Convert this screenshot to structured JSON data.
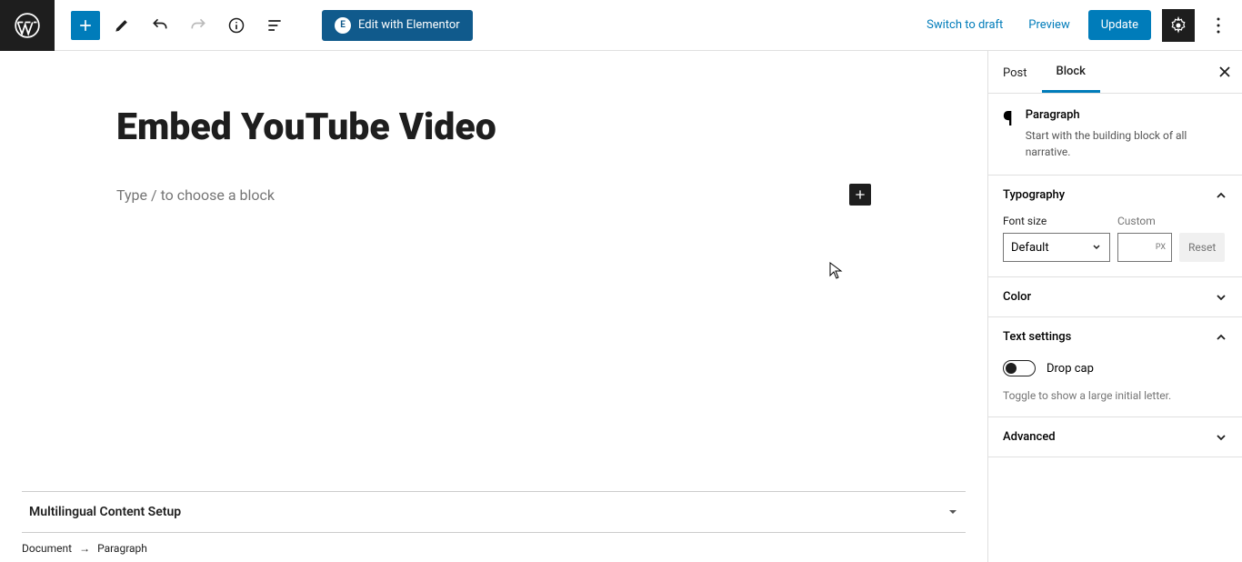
{
  "header": {
    "elementor_label": "Edit with Elementor",
    "switch_draft": "Switch to draft",
    "preview": "Preview",
    "update": "Update"
  },
  "editor": {
    "title": "Embed YouTube Video",
    "block_placeholder": "Type / to choose a block"
  },
  "footer": {
    "metabox_title": "Multilingual Content Setup",
    "breadcrumb_root": "Document",
    "breadcrumb_leaf": "Paragraph"
  },
  "sidebar": {
    "tabs": {
      "post": "Post",
      "block": "Block"
    },
    "block_info": {
      "title": "Paragraph",
      "desc": "Start with the building block of all narrative."
    },
    "typography": {
      "title": "Typography",
      "font_size_label": "Font size",
      "custom_label": "Custom",
      "default_option": "Default",
      "px_unit": "PX",
      "reset": "Reset"
    },
    "color": {
      "title": "Color"
    },
    "text_settings": {
      "title": "Text settings",
      "drop_cap": "Drop cap",
      "hint": "Toggle to show a large initial letter."
    },
    "advanced": {
      "title": "Advanced"
    }
  }
}
